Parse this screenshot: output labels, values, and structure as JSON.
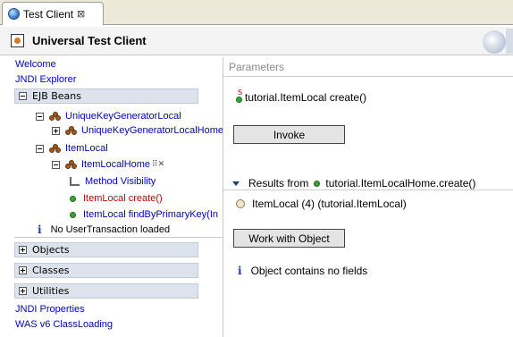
{
  "tab": {
    "label": "Test Client",
    "close": "⊠"
  },
  "header": {
    "title": "Universal Test Client"
  },
  "nav": {
    "welcome": "Welcome",
    "jndi_explorer": "JNDI Explorer",
    "ejb_beans": "EJB Beans",
    "tree": {
      "unique_key_gen": "UniqueKeyGeneratorLocal",
      "unique_key_gen_home": "UniqueKeyGeneratorLocalHome",
      "item_local": "ItemLocal",
      "item_local_home": "ItemLocalHome",
      "method_visibility": "Method Visibility",
      "create": "ItemLocal create()",
      "find_by_pk": "ItemLocal findByPrimaryKey(In"
    },
    "no_tx": "No UserTransaction loaded",
    "objects": "Objects",
    "classes": "Classes",
    "utilities": "Utilities",
    "jndi_properties": "JNDI Properties",
    "was_classloading": "WAS v6 ClassLoading"
  },
  "parameters": {
    "title": "Parameters",
    "method": "tutorial.ItemLocal create()",
    "static_marker": "S",
    "invoke_label": "Invoke"
  },
  "results": {
    "prefix": "Results from",
    "method": "tutorial.ItemLocalHome.create()",
    "item": "ItemLocal (4) (tutorial.ItemLocal)",
    "work_label": "Work with Object",
    "no_fields": "Object contains no fields"
  },
  "colors": {
    "link": "#0000cc",
    "section_bar": "#dde3ec",
    "selected_method": "#cc0000"
  }
}
